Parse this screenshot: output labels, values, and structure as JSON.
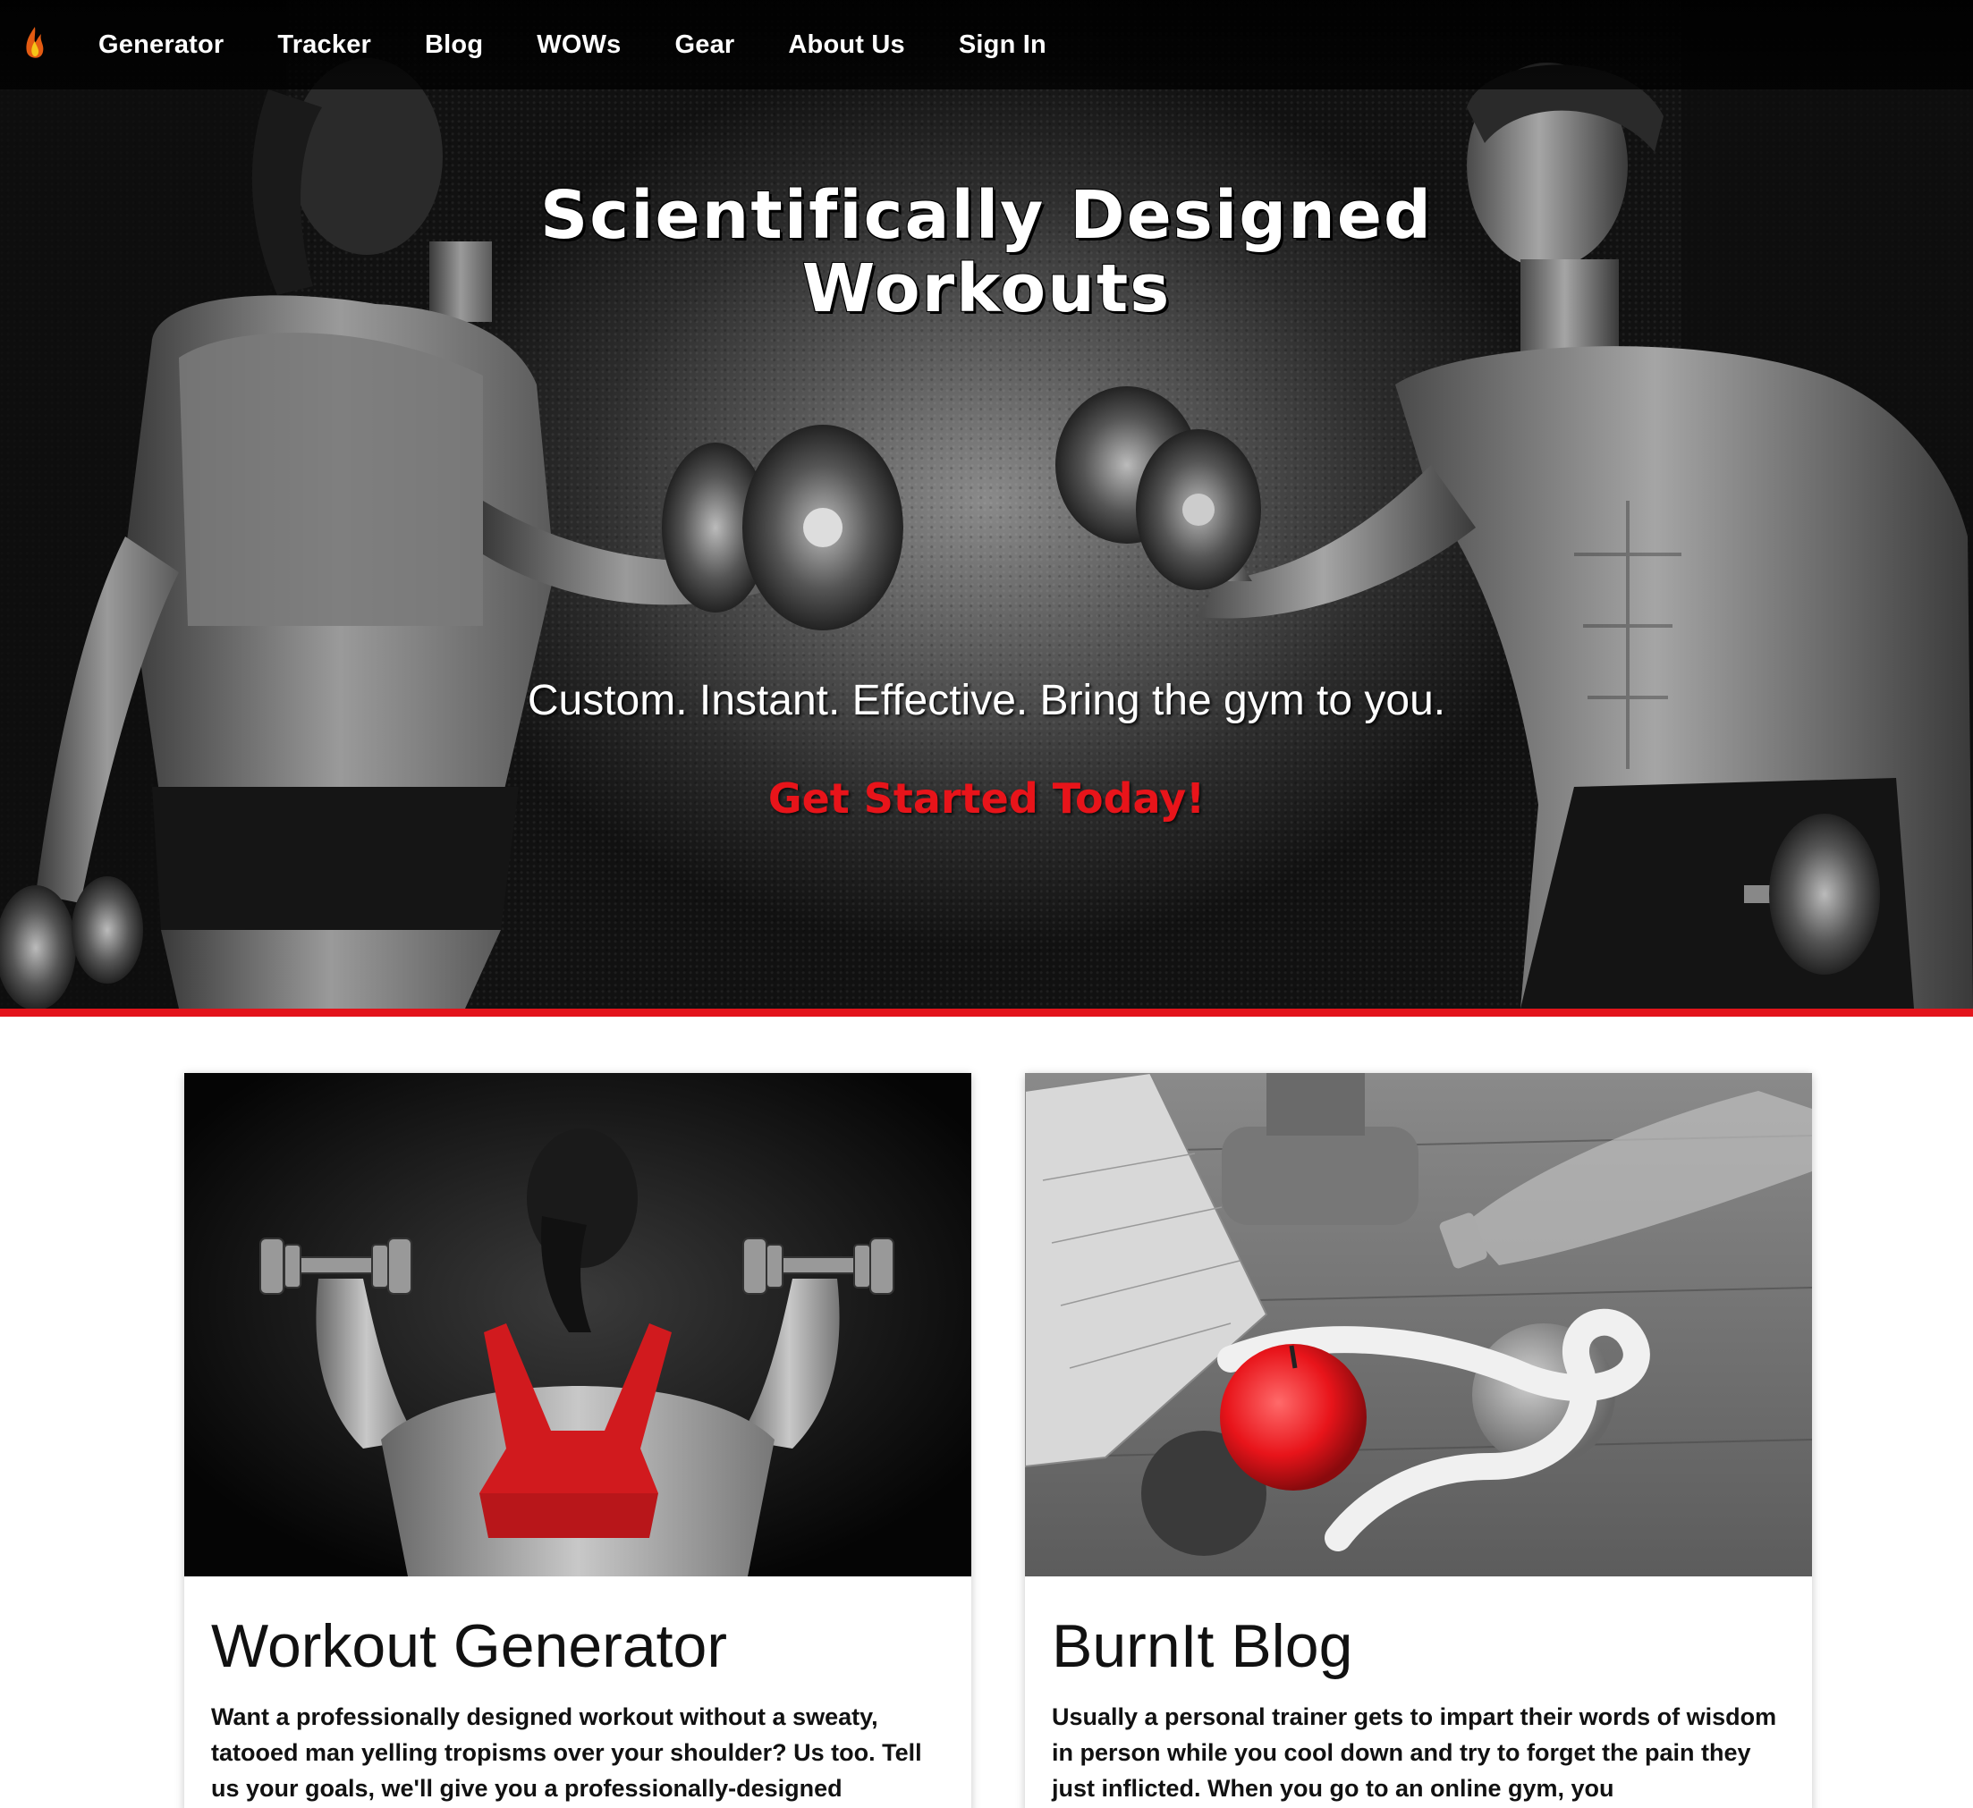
{
  "nav": {
    "logo": "flame-logo",
    "links": [
      "Generator",
      "Tracker",
      "Blog",
      "WOWs",
      "Gear",
      "About Us",
      "Sign In"
    ]
  },
  "hero": {
    "title_line1": "Scientifically Designed",
    "title_line2": "Workouts",
    "tagline": "Custom. Instant. Effective. Bring the gym to you.",
    "cta": "Get Started Today!"
  },
  "cards": [
    {
      "title": "Workout Generator",
      "text": "Want a professionally designed workout without a sweaty, tatooed man yelling tropisms over your shoulder? Us too. Tell us your goals, we'll give you a professionally-designed"
    },
    {
      "title": "BurnIt Blog",
      "text": "Usually a personal trainer gets to impart their words of wisdom in person while you cool down and try to forget the pain they just inflicted. When you go to an online gym, you"
    }
  ],
  "colors": {
    "accent": "#e3141b",
    "nav_bg": "#000000"
  }
}
